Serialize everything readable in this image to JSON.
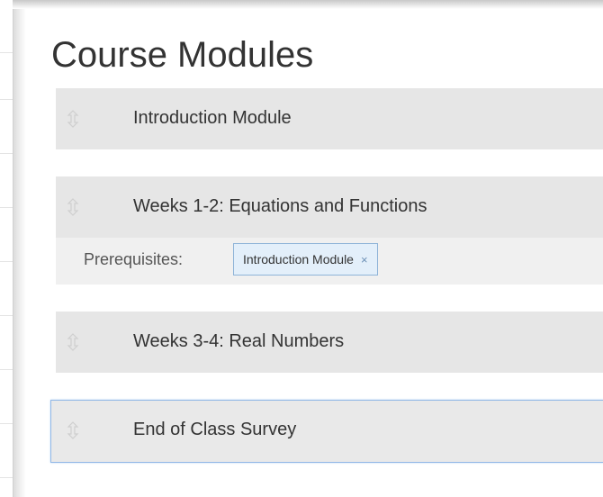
{
  "page": {
    "title": "Course Modules"
  },
  "modules": [
    {
      "label": "Introduction Module",
      "selected": false
    },
    {
      "label": "Weeks 1-2: Equations and Functions",
      "selected": false,
      "prerequisites": {
        "label": "Prerequisites:",
        "items": [
          {
            "label": "Introduction Module",
            "remove_glyph": "×"
          }
        ]
      }
    },
    {
      "label": "Weeks 3-4: Real Numbers",
      "selected": false
    },
    {
      "label": "End of Class Survey",
      "selected": true
    }
  ],
  "icons": {
    "drag_handle": "drag-handle-icon",
    "remove": "close-icon"
  },
  "colors": {
    "module_bg": "#e6e6e6",
    "prereq_bg": "#f0f0f0",
    "chip_bg": "#e3effa",
    "chip_border": "#8fb4d8",
    "selected_border": "#92b8e6",
    "text": "#333333"
  }
}
